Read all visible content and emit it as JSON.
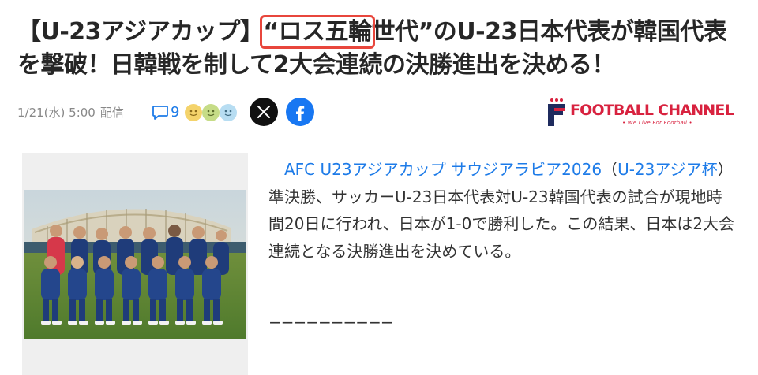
{
  "article": {
    "title_pre": "【U-23アジアカップ】",
    "title_highlight": "“ロス五輪",
    "title_post": "世代”のU-23日本代表が韓国代表を撃破！日韓戦を制して2大会連続の決勝進出を決める！",
    "date": "1/21(水) 5:00",
    "date_source": "配信",
    "comment_count": "9",
    "body_link1": "AFC U23アジアカップ サウジアラビア2026",
    "body_mid1": "（",
    "body_link2": "U-23アジア杯",
    "body_rest": "）準決勝、サッカーU-23日本代表対U-23韓国代表の試合が現地時間20日に行われ、日本が1-0で勝利した。この結果、日本は2大会連続となる決勝進出を決めている。",
    "divider": "−−−−−−−−−−"
  },
  "source_logo": {
    "name": "FOOTBALL CHANNEL",
    "tagline": "• We Live For Football •"
  },
  "icons": {
    "comment": "comment-bubble-icon",
    "reactions": "reaction-faces-icon",
    "x": "x-logo-icon",
    "facebook": "facebook-logo-icon"
  },
  "colors": {
    "link": "#1d7be8",
    "highlight_box": "#e8463c",
    "brand": "#d8223f",
    "facebook": "#1877f2"
  }
}
